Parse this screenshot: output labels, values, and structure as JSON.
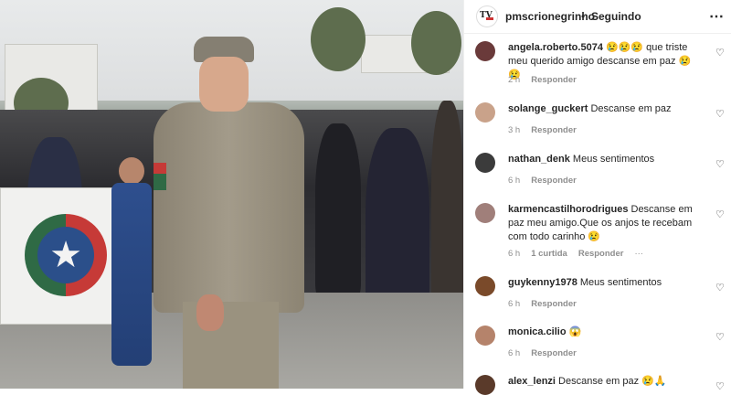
{
  "post": {
    "username": "pmscrionegrinho",
    "separator": "•",
    "follow_status": "Seguindo",
    "more_icon": "more-horizontal-icon"
  },
  "comments": [
    {
      "username": "angela.roberto.5074",
      "text_before": "😢😢😢 que triste meu querido amigo descanse em paz 😢😢",
      "time": "2 h",
      "likes": "",
      "reply": "Responder",
      "avatar_color": "#6a3a3a"
    },
    {
      "username": "solange_guckert",
      "text_before": "Descanse em paz",
      "time": "3 h",
      "likes": "",
      "reply": "Responder",
      "avatar_color": "#c9a28a"
    },
    {
      "username": "nathan_denk",
      "text_before": "Meus sentimentos",
      "time": "6 h",
      "likes": "",
      "reply": "Responder",
      "avatar_color": "#3b3b3b"
    },
    {
      "username": "karmencastilhorodrigues",
      "text_before": "Descanse em paz meu amigo.Que os anjos te recebam com todo carinho 😢",
      "time": "6 h",
      "likes": "1 curtida",
      "reply": "Responder",
      "avatar_color": "#a07f7a"
    },
    {
      "username": "guykenny1978",
      "text_before": "Meus sentimentos",
      "time": "6 h",
      "likes": "",
      "reply": "Responder",
      "avatar_color": "#7a4a2a"
    },
    {
      "username": "monica.cilio",
      "text_before": "😱",
      "time": "6 h",
      "likes": "",
      "reply": "Responder",
      "avatar_color": "#b5836b"
    },
    {
      "username": "alex_lenzi",
      "text_before": "Descanse em paz 😢🙏",
      "time": "",
      "likes": "",
      "reply": "",
      "avatar_color": "#5a3a2a"
    }
  ],
  "ui": {
    "heart_icon": "heart-outline-icon",
    "reply_more": "···"
  }
}
